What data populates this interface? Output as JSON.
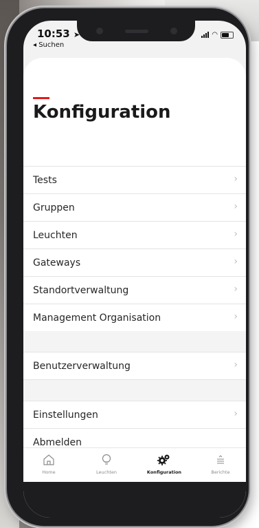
{
  "status_bar": {
    "time": "10:53",
    "back_label": "◂ Suchen"
  },
  "page": {
    "title": "Konfiguration",
    "accent_color": "#e31a1a"
  },
  "groups": [
    {
      "items": [
        {
          "label": "Tests",
          "chevron": true
        },
        {
          "label": "Gruppen",
          "chevron": true
        },
        {
          "label": "Leuchten",
          "chevron": true
        },
        {
          "label": "Gateways",
          "chevron": true
        },
        {
          "label": "Standortverwaltung",
          "chevron": true
        },
        {
          "label": "Management Organisation",
          "chevron": true
        }
      ]
    },
    {
      "items": [
        {
          "label": "Benutzerverwaltung",
          "chevron": true
        }
      ]
    },
    {
      "items": [
        {
          "label": "Einstellungen",
          "chevron": true
        },
        {
          "label": "Abmelden",
          "chevron": false
        }
      ]
    }
  ],
  "tabbar": {
    "items": [
      {
        "label": "Home",
        "icon": "home-icon",
        "active": false
      },
      {
        "label": "Leuchten",
        "icon": "lightbulb-icon",
        "active": false
      },
      {
        "label": "Konfiguration",
        "icon": "gears-icon",
        "active": true
      },
      {
        "label": "Berichte",
        "icon": "report-icon",
        "active": false
      }
    ]
  }
}
